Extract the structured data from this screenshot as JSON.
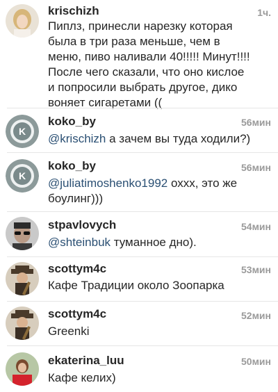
{
  "comments": [
    {
      "username": "krischizh",
      "time": "1ч.",
      "avatar": "photo of young woman",
      "text": "Пиплз, принесли нарезку которая\nбыла в три раза меньше, чем в\nменю, пиво наливали 40!!!!! Минут!!!!\nПосле чего сказали, что оно кислое\nи попросили выбрать другое, дико\nвоняет сигаретами (("
    },
    {
      "username": "koko_by",
      "time": "56мин",
      "avatar": "koko-logo",
      "mention": "@krischizh",
      "text": " а зачем вы туда ходили?)"
    },
    {
      "username": "koko_by",
      "time": "56мин",
      "avatar": "koko-logo",
      "mention": "@juliatimoshenko1992",
      "text": " охxx, это же\nбоулинг)))"
    },
    {
      "username": "stpavlovych",
      "time": "54мин",
      "avatar": "man with sunglasses",
      "mention": "@shteinbuk",
      "text": " туманное дно)."
    },
    {
      "username": "scottym4c",
      "time": "53мин",
      "avatar": "man in hat with guitar",
      "text": "Кафе Традиции около Зоопарка"
    },
    {
      "username": "scottym4c",
      "time": "52мин",
      "avatar": "man in hat with guitar",
      "text": "Greenki"
    },
    {
      "username": "ekaterina_luu",
      "time": "50мин",
      "avatar": "woman in red",
      "text": "Кафе келих)"
    }
  ],
  "colors": {
    "mention": "#2a4f73",
    "time": "#9a9a9a",
    "text": "#262626",
    "divider": "#e6e6e6"
  }
}
